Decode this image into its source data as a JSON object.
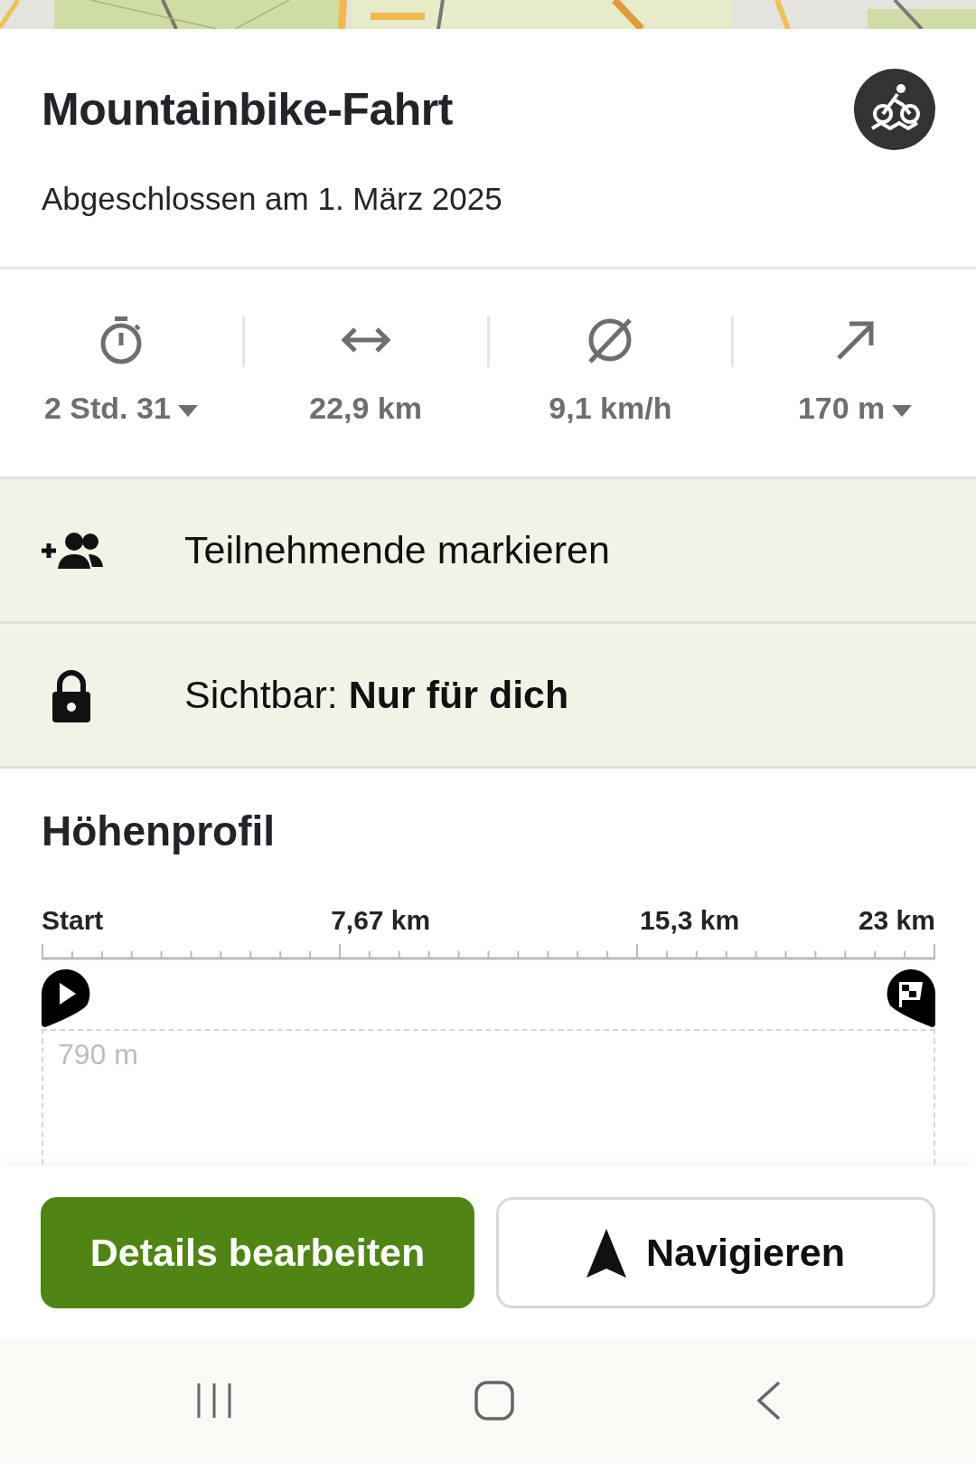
{
  "activity": {
    "title": "Mountainbike-Fahrt",
    "subtitle": "Abgeschlossen am 1. März 2025"
  },
  "stats": [
    {
      "kind": "duration",
      "value": "2 Std. 31",
      "dropdown": true
    },
    {
      "kind": "distance",
      "value": "22,9 km",
      "dropdown": false
    },
    {
      "kind": "speed",
      "value": "9,1 km/h",
      "dropdown": false
    },
    {
      "kind": "ascent",
      "value": "170 m",
      "dropdown": true
    }
  ],
  "actions": [
    {
      "kind": "participants",
      "text": "Teilnehmende markieren"
    },
    {
      "kind": "visibility",
      "text": "Sichtbar: **Nur für dich**"
    }
  ],
  "profile": {
    "title": "Höhenprofil",
    "axis_labels": [
      "Start",
      "7,67 km",
      "15,3 km",
      "23 km"
    ],
    "elevation_label": "790 m"
  },
  "buttons": [
    {
      "kind": "primary",
      "label": "Details bearbeiten"
    },
    {
      "kind": "navigate",
      "label": "Navigieren"
    }
  ]
}
